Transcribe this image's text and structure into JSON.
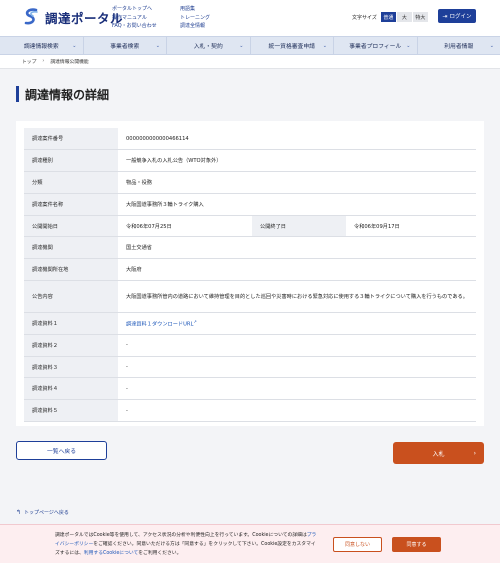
{
  "header": {
    "logo_text": "調達ポータル",
    "links_col1": [
      "ポータルトップへ",
      "操作マニュアル",
      "FAQ・お問い合わせ"
    ],
    "links_col2": [
      "用語集",
      "トレーニング",
      "調達全情報"
    ],
    "font_size_label": "文字サイズ",
    "font_sizes": [
      "普通",
      "大",
      "特大"
    ],
    "login_label": "ログイン",
    "brand_color": "#1e3f99"
  },
  "nav": {
    "items": [
      "調達情報検索",
      "事業者検索",
      "入札・契約",
      "統一資格審査申請",
      "事業者プロフィール",
      "利用者情報"
    ]
  },
  "breadcrumb": {
    "home": "トップ",
    "current": "調達情報公開機能"
  },
  "page_title": "調達情報の詳細",
  "details": {
    "case_number": {
      "label": "調達案件番号",
      "value": "0000000000000466114"
    },
    "type": {
      "label": "調達種別",
      "value": "一般競争入札の入札公告（WTO対象外）"
    },
    "category": {
      "label": "分類",
      "value": "物品・役務"
    },
    "case_name": {
      "label": "調達案件名称",
      "value": "大阪国道事務所３輪トライク購入"
    },
    "pub_start": {
      "label": "公開開始日",
      "value": "令和06年07月25日"
    },
    "pub_end": {
      "label": "公開終了日",
      "value": "令和06年09月17日"
    },
    "agency": {
      "label": "調達機関",
      "value": "国土交通省"
    },
    "location": {
      "label": "調達機関所在地",
      "value": "大阪府"
    },
    "notice": {
      "label": "公告内容",
      "value": "大阪国道事務所管内の道路において維持管理を目的とした巡回や災害時における緊急対応に使用する３輪トライクについて購入を行うものである。"
    },
    "doc1": {
      "label": "調達資料１",
      "value": "調達資料１ダウンロードURL"
    },
    "doc2": {
      "label": "調達資料２",
      "value": "-"
    },
    "doc3": {
      "label": "調達資料３",
      "value": "-"
    },
    "doc4": {
      "label": "調達資料４",
      "value": "-"
    },
    "doc5": {
      "label": "調達資料５",
      "value": "-"
    }
  },
  "actions": {
    "back_label": "一覧へ戻る",
    "bid_label": "入札",
    "accent_color": "#c9501e"
  },
  "to_top_label": "トップページへ戻る",
  "cookie": {
    "text_1": "調達ポータルではCookie等を使用して、アクセス状況の分析や利便性向上を行っています。Cookieについての詳細は",
    "privacy_link": "プライバシーポリシー",
    "text_2": "をご確認ください。同意いただける方は「同意する」をクリックして下さい。Cookie設定をカスタマイズするには、",
    "cookie_link": "利用するCookieについて",
    "text_3": "をご利用ください。",
    "decline_label": "同意しない",
    "accept_label": "同意する"
  }
}
